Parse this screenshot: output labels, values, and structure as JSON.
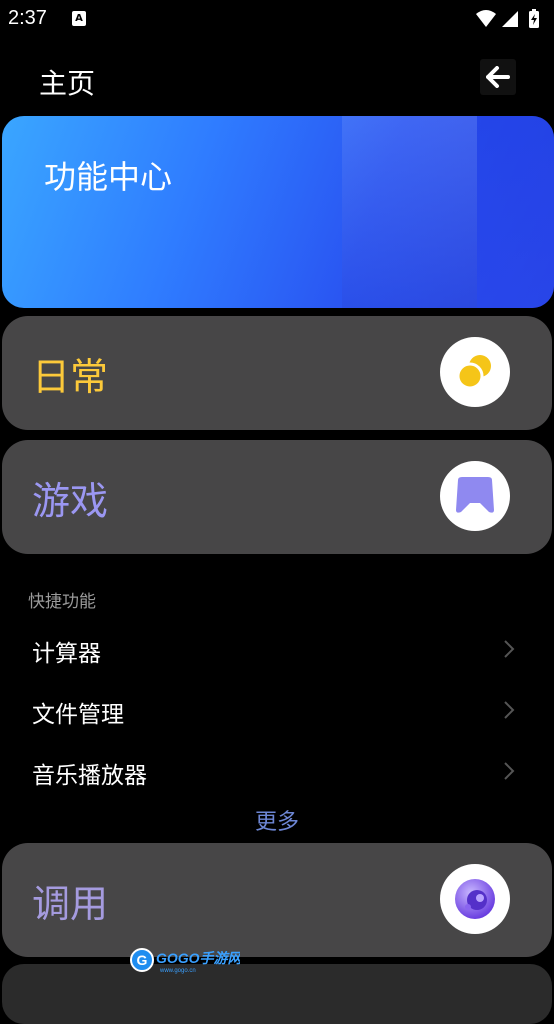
{
  "status_bar": {
    "time": "2:37",
    "notification_icon": "a-icon",
    "indicator_icons": [
      "wifi-icon",
      "signal-icon",
      "battery-charging-icon"
    ]
  },
  "app_bar": {
    "title": "主页",
    "back_icon": "arrow-left-icon"
  },
  "banner": {
    "title": "功能中心"
  },
  "cards": [
    {
      "label": "日常",
      "label_color": "#FCC93A",
      "icon": "coins-icon"
    },
    {
      "label": "游戏",
      "label_color": "#9B97F2",
      "icon": "gamepad-icon"
    }
  ],
  "quick": {
    "header": "快捷功能",
    "items": [
      {
        "label": "计算器"
      },
      {
        "label": "文件管理"
      },
      {
        "label": "音乐播放器"
      }
    ],
    "more": "更多"
  },
  "call_card": {
    "label": "调用",
    "label_color": "#A59BDF",
    "icon": "gear-ball-icon"
  },
  "watermark": {
    "text": "GOGO手游网",
    "sub": "www.gogo.cn"
  }
}
